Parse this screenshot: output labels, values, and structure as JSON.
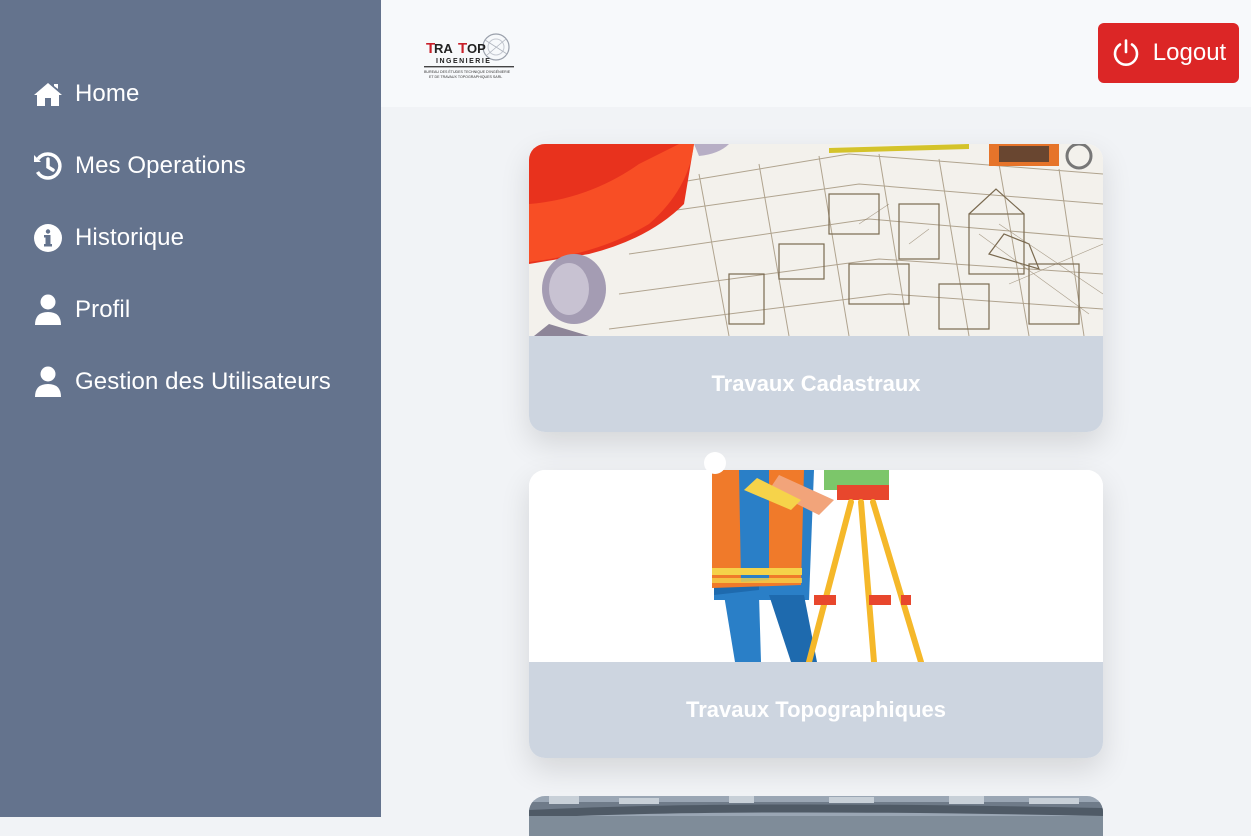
{
  "sidebar": {
    "items": [
      {
        "label": "Home",
        "icon": "home-icon"
      },
      {
        "label": "Mes Operations",
        "icon": "history-icon"
      },
      {
        "label": "Historique",
        "icon": "info-icon"
      },
      {
        "label": "Profil",
        "icon": "user-icon"
      },
      {
        "label": "Gestion des Utilisateurs",
        "icon": "user-icon"
      }
    ]
  },
  "header": {
    "logo": {
      "line1": "TRA TOP",
      "line2": "INGENIERIE",
      "line3": "BUREAU DES ÉTUDES TECHNIQUE D'INGÉNIERIE",
      "line4": "ET DE TRAVAUX TOPOGRAPHIQUES SARL"
    },
    "logout_label": "Logout"
  },
  "cards": [
    {
      "title": "Travaux Cadastraux"
    },
    {
      "title": "Travaux Topographiques"
    }
  ],
  "colors": {
    "sidebar": "#64738d",
    "logout": "#dc2626",
    "caption": "#cdd5e0",
    "logo_red": "#c8202a"
  }
}
